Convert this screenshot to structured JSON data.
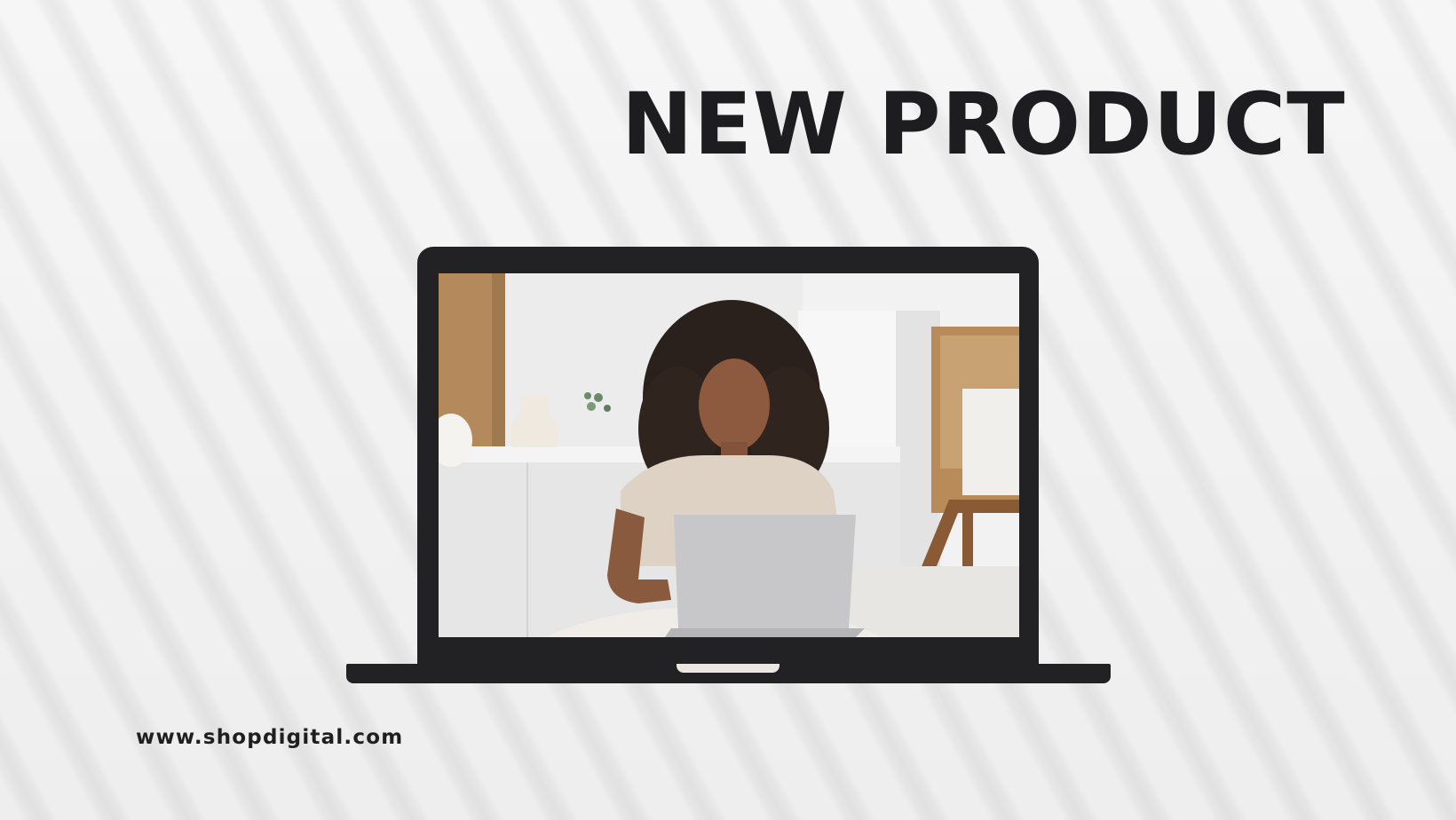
{
  "headline": "NEW PRODUCT",
  "website": "www.shopdigital.com",
  "colors": {
    "text": "#1d1d1f",
    "laptop_body": "#222225",
    "background": "#f3f3f3"
  }
}
